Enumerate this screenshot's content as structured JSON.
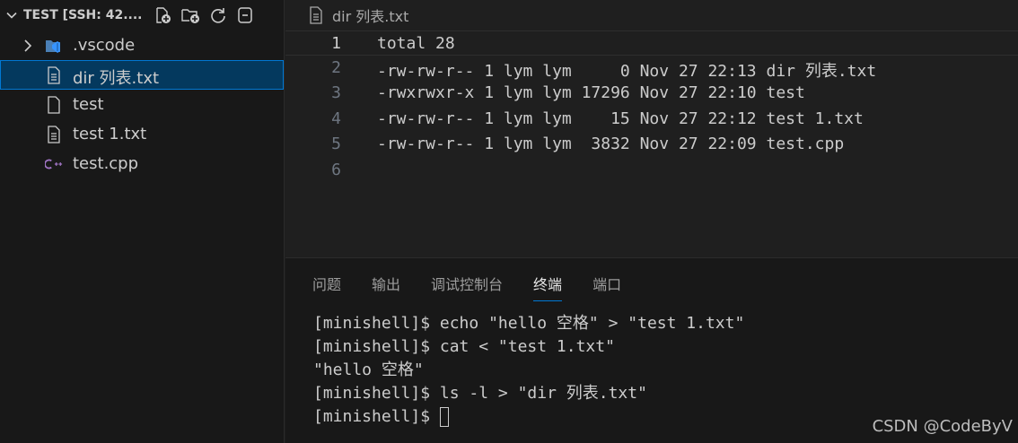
{
  "explorer": {
    "title": "TEST [SSH: 42....",
    "items": [
      {
        "label": ".vscode",
        "icon": "vscode-folder-icon",
        "type": "folder"
      },
      {
        "label": "dir 列表.txt",
        "icon": "text-file-icon",
        "type": "file",
        "selected": true
      },
      {
        "label": "test",
        "icon": "file-icon",
        "type": "file"
      },
      {
        "label": "test 1.txt",
        "icon": "text-file-icon",
        "type": "file"
      },
      {
        "label": "test.cpp",
        "icon": "cpp-icon",
        "type": "file"
      }
    ]
  },
  "editor": {
    "breadcrumb": "dir 列表.txt",
    "lines": [
      {
        "num": "1",
        "text": "total 28"
      },
      {
        "num": "2",
        "text": "-rw-rw-r-- 1 lym lym     0 Nov 27 22:13 dir 列表.txt"
      },
      {
        "num": "3",
        "text": "-rwxrwxr-x 1 lym lym 17296 Nov 27 22:10 test"
      },
      {
        "num": "4",
        "text": "-rw-rw-r-- 1 lym lym    15 Nov 27 22:12 test 1.txt"
      },
      {
        "num": "5",
        "text": "-rw-rw-r-- 1 lym lym  3832 Nov 27 22:09 test.cpp"
      },
      {
        "num": "6",
        "text": ""
      }
    ]
  },
  "panel": {
    "tabs": [
      "问题",
      "输出",
      "调试控制台",
      "终端",
      "端口"
    ],
    "active_tab": "终端",
    "terminal_lines": [
      "[minishell]$ echo \"hello 空格\" > \"test 1.txt\"",
      "[minishell]$ cat < \"test 1.txt\"",
      "\"hello 空格\"",
      "[minishell]$ ls -l > \"dir 列表.txt\"",
      "[minishell]$ "
    ]
  },
  "watermark": "CSDN @CodeByV",
  "colors": {
    "accent": "#0078d4",
    "selection": "#04395e",
    "vscode_blue": "#3794ff",
    "cpp_purple": "#a074c4"
  }
}
